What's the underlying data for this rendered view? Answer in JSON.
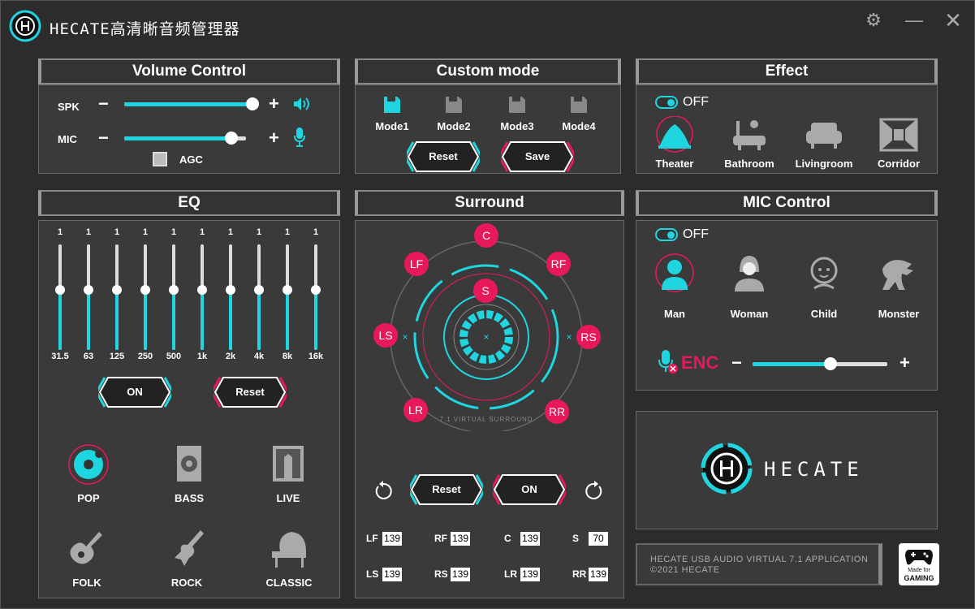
{
  "app": {
    "title": "HECATE高清晰音频管理器"
  },
  "volume": {
    "title": "Volume Control",
    "spk_label": "SPK",
    "mic_label": "MIC",
    "minus": "−",
    "plus": "+",
    "spk_level": 1.0,
    "mic_level": 0.88,
    "agc_label": "AGC"
  },
  "custom": {
    "title": "Custom mode",
    "modes": [
      "Mode1",
      "Mode2",
      "Mode3",
      "Mode4"
    ],
    "reset": "Reset",
    "save": "Save"
  },
  "effect": {
    "title": "Effect",
    "toggle": "OFF",
    "items": [
      "Theater",
      "Bathroom",
      "Livingroom",
      "Corridor"
    ]
  },
  "eq": {
    "title": "EQ",
    "values": [
      "1",
      "1",
      "1",
      "1",
      "1",
      "1",
      "1",
      "1",
      "1",
      "1"
    ],
    "bands": [
      "31.5",
      "63",
      "125",
      "250",
      "500",
      "1k",
      "2k",
      "4k",
      "8k",
      "16k"
    ],
    "on": "ON",
    "reset": "Reset",
    "presets": [
      "POP",
      "BASS",
      "LIVE",
      "FOLK",
      "ROCK",
      "CLASSIC"
    ]
  },
  "surround": {
    "title": "Surround",
    "channels": [
      "C",
      "LF",
      "RF",
      "S",
      "LS",
      "RS",
      "LR",
      "RR"
    ],
    "ring_text": "7.1 VIRTUAL SURROUND",
    "reset": "Reset",
    "on": "ON",
    "values": [
      {
        "label": "LF",
        "value": "139"
      },
      {
        "label": "RF",
        "value": "139"
      },
      {
        "label": "C",
        "value": "139"
      },
      {
        "label": "S",
        "value": "70"
      },
      {
        "label": "LS",
        "value": "139"
      },
      {
        "label": "RS",
        "value": "139"
      },
      {
        "label": "LR",
        "value": "139"
      },
      {
        "label": "RR",
        "value": "139"
      }
    ]
  },
  "mic": {
    "title": "MIC Control",
    "toggle": "OFF",
    "items": [
      "Man",
      "Woman",
      "Child",
      "Monster"
    ],
    "enc": "ENC",
    "enc_level": 0.58
  },
  "brand": {
    "name": "HECATE"
  },
  "footer": {
    "line1": "HECATE USB AUDIO VIRTUAL 7.1 APPLICATION",
    "line2": "©2021 HECATE",
    "badge1": "Made for",
    "badge2": "GAMING"
  },
  "colors": {
    "accent": "#1fd6e0",
    "pink": "#e8195a"
  }
}
